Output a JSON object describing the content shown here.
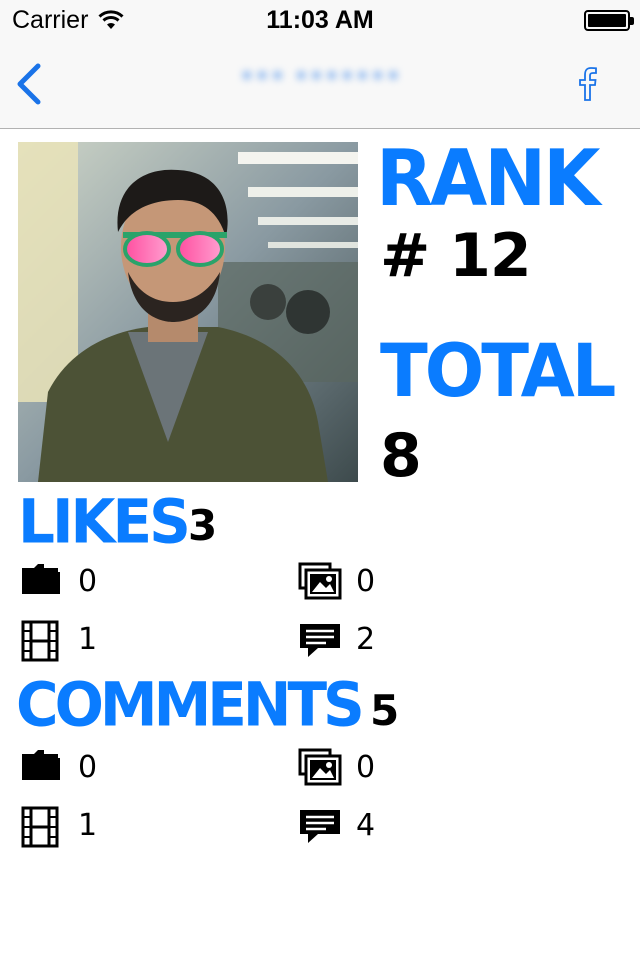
{
  "status_bar": {
    "carrier": "Carrier",
    "time": "11:03 AM"
  },
  "nav": {
    "title": "••• •••••••",
    "back_icon": "chevron-left-icon",
    "facebook_icon": "facebook-icon"
  },
  "profile": {
    "rank_label": "RANK",
    "rank_value": "# 12",
    "total_label": "TOTAL",
    "total_value": "8"
  },
  "likes": {
    "label": "LIKES",
    "count": "3",
    "items": [
      {
        "icon": "folder-icon",
        "value": "0"
      },
      {
        "icon": "photos-icon",
        "value": "0"
      },
      {
        "icon": "film-icon",
        "value": "1"
      },
      {
        "icon": "comment-icon",
        "value": "2"
      }
    ]
  },
  "comments": {
    "label": "COMMENTS",
    "count": "5",
    "items": [
      {
        "icon": "folder-icon",
        "value": "0"
      },
      {
        "icon": "photos-icon",
        "value": "0"
      },
      {
        "icon": "film-icon",
        "value": "1"
      },
      {
        "icon": "comment-icon",
        "value": "4"
      }
    ]
  },
  "colors": {
    "accent": "#0a7cff",
    "nav_tint": "#1a73e8",
    "bar_bg": "#f8f8f8"
  }
}
